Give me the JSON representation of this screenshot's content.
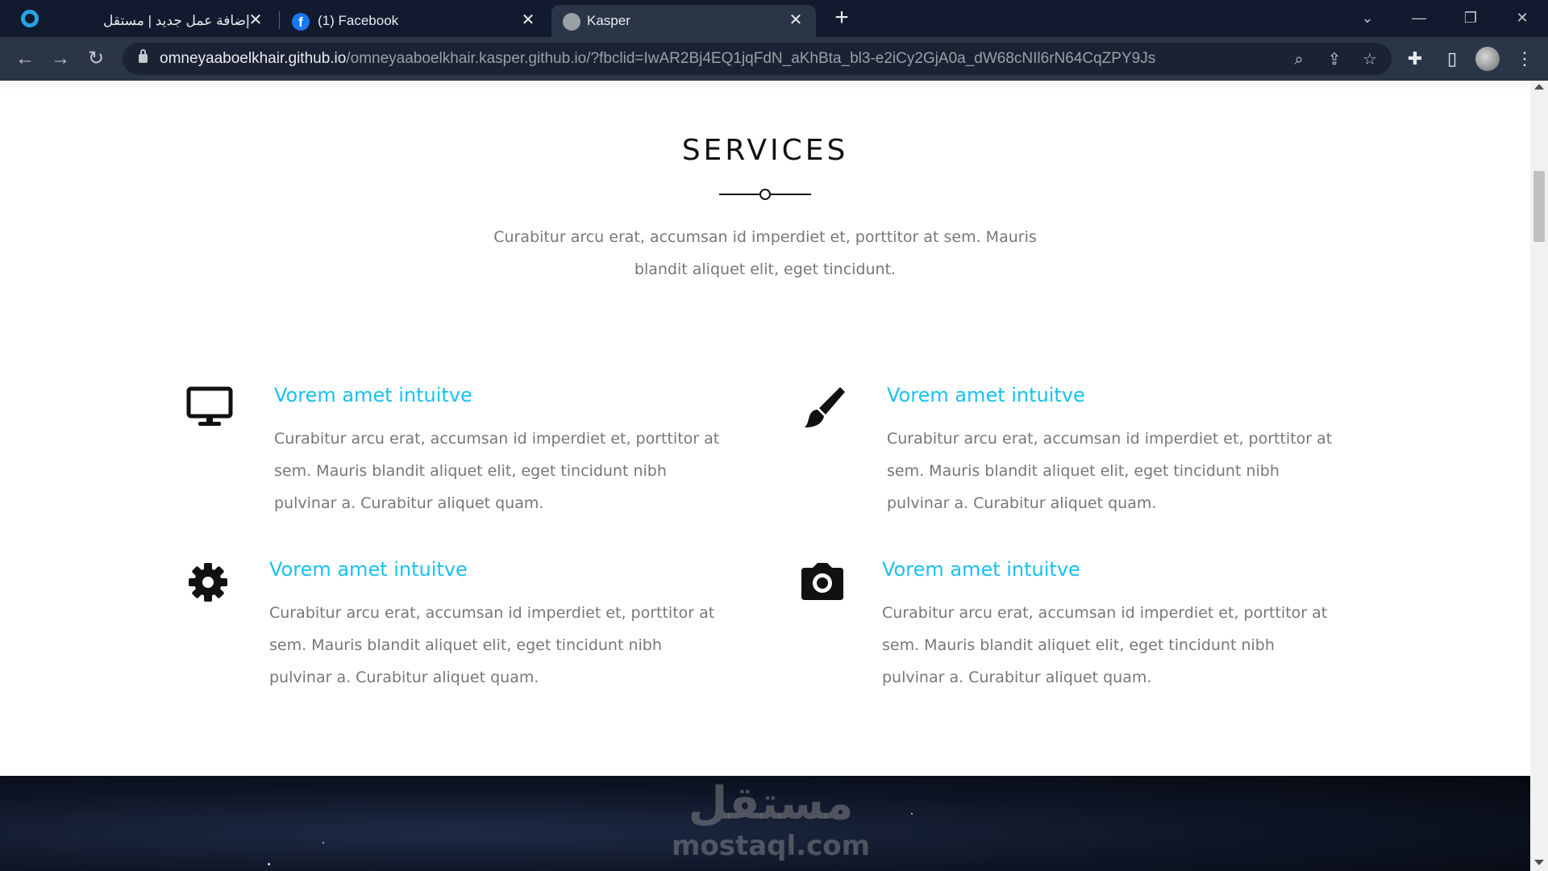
{
  "browser": {
    "tabs": [
      {
        "title": "إضافة عمل جديد | مستقل",
        "close": "✕"
      },
      {
        "title": "(1) Facebook",
        "close": "✕"
      },
      {
        "title": "Kasper",
        "close": "✕"
      }
    ],
    "new_tab": "+",
    "url_host": "omneyaaboelkhair.github.io",
    "url_path": "/omneyaaboelkhair.kasper.github.io/?fbclid=IwAR2Bj4EQ1jqFdN_aKhBta_bl3-e2iCy2GjA0a_dW68cNIl6rN64CqZPY9Js"
  },
  "page": {
    "section_title": "SERVICES",
    "section_desc": "Curabitur arcu erat, accumsan id imperdiet et, porttitor at sem. Mauris blandit aliquet elit, eget tincidunt.",
    "services": [
      {
        "icon": "desktop-icon",
        "title": "Vorem amet intuitve",
        "desc": "Curabitur arcu erat, accumsan id imperdiet et, porttitor at sem. Mauris blandit aliquet elit, eget tincidunt nibh pulvinar a. Curabitur aliquet quam."
      },
      {
        "icon": "paint-brush-icon",
        "title": "Vorem amet intuitve",
        "desc": "Curabitur arcu erat, accumsan id imperdiet et, porttitor at sem. Mauris blandit aliquet elit, eget tincidunt nibh pulvinar a. Curabitur aliquet quam."
      },
      {
        "icon": "gear-icon",
        "title": "Vorem amet intuitve",
        "desc": "Curabitur arcu erat, accumsan id imperdiet et, porttitor at sem. Mauris blandit aliquet elit, eget tincidunt nibh pulvinar a. Curabitur aliquet quam."
      },
      {
        "icon": "camera-icon",
        "title": "Vorem amet intuitve",
        "desc": "Curabitur arcu erat, accumsan id imperdiet et, porttitor at sem. Mauris blandit aliquet elit, eget tincidunt nibh pulvinar a. Curabitur aliquet quam."
      }
    ],
    "watermark_ar": "مستقل",
    "watermark_en": "mostaql.com"
  },
  "colors": {
    "accent": "#19c1ef",
    "chrome_dark": "#111a2e",
    "chrome_toolbar": "#2b3548",
    "text_muted": "#777777"
  }
}
